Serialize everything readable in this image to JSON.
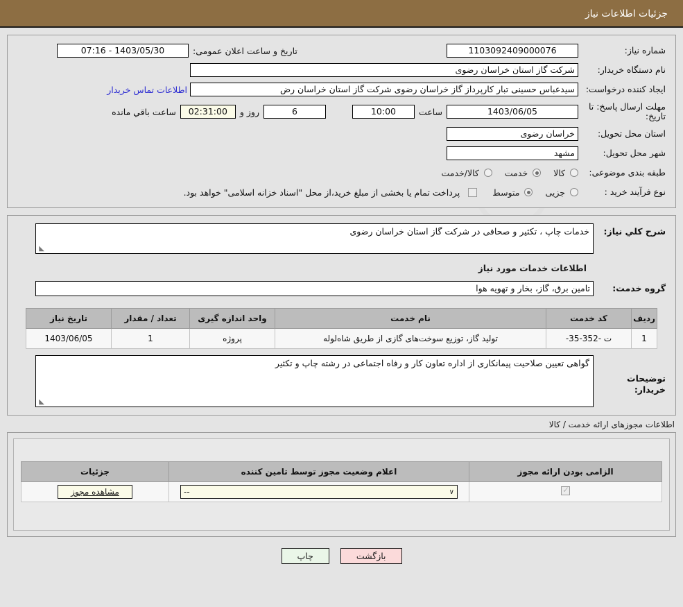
{
  "header": {
    "title": "جزئیات اطلاعات نیاز"
  },
  "info": {
    "need_number_label": "شماره نیاز:",
    "need_number_value": "1103092409000076",
    "announce_datetime_label": "تاریخ و ساعت اعلان عمومی:",
    "announce_datetime_value": "1403/05/30 - 07:16",
    "buyer_org_label": "نام دستگاه خریدار:",
    "buyer_org_value": "شرکت گاز استان خراسان رضوی",
    "creator_label": "ایجاد کننده درخواست:",
    "creator_value": "سیدعباس حسینی تبار کارپرداز گاز خراسان رضوی شرکت گاز استان خراسان رض",
    "buyer_contact_link": "اطلاعات تماس خریدار",
    "deadline_label": "مهلت ارسال پاسخ: تا تاریخ:",
    "deadline_date": "1403/06/05",
    "deadline_hour_label": "ساعت",
    "deadline_hour_value": "10:00",
    "remaining_days": "6",
    "remaining_days_label": "روز و",
    "remaining_time": "02:31:00",
    "remaining_time_label": "ساعت باقي مانده",
    "province_label": "استان محل تحویل:",
    "province_value": "خراسان رضوی",
    "city_label": "شهر محل تحویل:",
    "city_value": "مشهد",
    "category_label": "طبقه بندی موضوعی:",
    "category_options": [
      {
        "label": "کالا",
        "selected": false
      },
      {
        "label": "خدمت",
        "selected": true
      },
      {
        "label": "کالا/خدمت",
        "selected": false
      }
    ],
    "process_label": "نوع فرآیند خرید :",
    "process_options": [
      {
        "label": "جزیی",
        "selected": false
      },
      {
        "label": "متوسط",
        "selected": true
      }
    ],
    "treasury_checkbox_checked": false,
    "treasury_note": "پرداخت تمام یا بخشی از مبلغ خرید،از محل \"اسناد خزانه اسلامی\" خواهد بود."
  },
  "need_summary": {
    "label": "شرح کلي نیاز:",
    "value": "خدمات چاپ ، تکثیر و صحافی در شرکت گاز استان خراسان رضوی"
  },
  "service_section": {
    "heading": "اطلاعات خدمات مورد نیاز",
    "group_label": "گروه خدمت:",
    "group_value": "تامین برق، گاز، بخار و تهویه هوا",
    "table": {
      "columns": [
        "ردیف",
        "کد خدمت",
        "نام خدمت",
        "واحد اندازه گیری",
        "تعداد / مقدار",
        "تاریخ نیاز"
      ],
      "rows": [
        {
          "row_no": "1",
          "service_code": "ت -352-35-",
          "service_name": "تولید گاز، توزیع سوخت‌های گازی از طریق شاه‌لوله",
          "unit": "پروژه",
          "quantity": "1",
          "need_date": "1403/06/05"
        }
      ]
    }
  },
  "buyer_notes": {
    "label": "توضیحات خریدار:",
    "value": "گواهی تعیین صلاحیت پیمانکاری از اداره تعاون کار و رفاه اجتماعی در رشته چاپ و تکثیر"
  },
  "permits": {
    "heading": "اطلاعات مجوزهای ارائه خدمت / کالا",
    "columns": [
      "الزامی بودن ارائه مجوز",
      "اعلام وضعیت مجوز توسط تامین کننده",
      "جزئیات"
    ],
    "rows": [
      {
        "required_checked": true,
        "status_value": "--",
        "details_button": "مشاهده مجوز"
      }
    ]
  },
  "footer": {
    "print_label": "چاپ",
    "back_label": "بازگشت"
  },
  "colors": {
    "title_bar": "#8d6e43",
    "page_bg": "#e4e4e4",
    "link": "#2a2ad2",
    "print_btn": "#eaf6e8",
    "back_btn": "#fbdada",
    "table_header": "#bcbcbc"
  }
}
